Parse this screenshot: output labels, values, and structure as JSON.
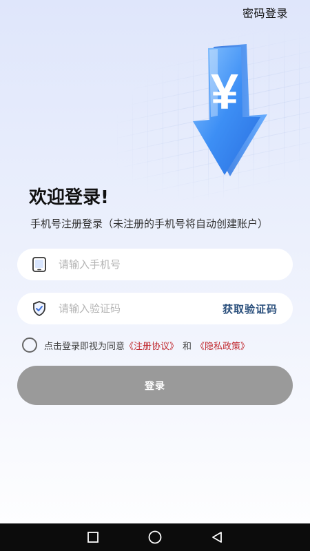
{
  "header": {
    "password_login_link": "密码登录"
  },
  "welcome": {
    "title": "欢迎登录!",
    "subtitle": "手机号注册登录（未注册的手机号将自动创建账户）"
  },
  "phone_field": {
    "placeholder": "请输入手机号",
    "value": ""
  },
  "code_field": {
    "placeholder": "请输入验证码",
    "value": "",
    "get_code_label": "获取验证码"
  },
  "agreement": {
    "checked": false,
    "prefix": "点击登录即视为同意",
    "register_agreement": "《注册协议》",
    "and": "和",
    "privacy_policy": "《隐私政策》"
  },
  "login_button": {
    "label": "登录"
  },
  "hero": {
    "symbol": "¥"
  },
  "colors": {
    "accent_blue": "#2a4f7c",
    "link_red": "#c0272d",
    "button_disabled": "#9a9a9a"
  }
}
